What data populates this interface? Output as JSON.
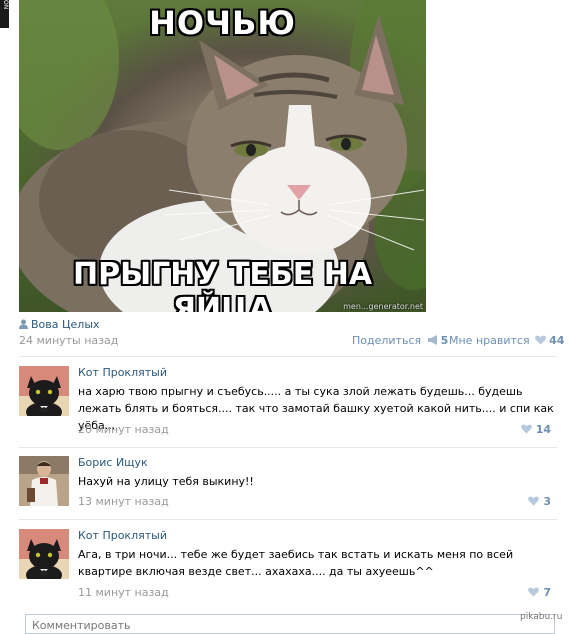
{
  "corner_text": "ON",
  "meme": {
    "top_text": "НОЧЬЮ",
    "bottom_text": "ПРЫГНУ ТЕБЕ НА ЯЙЦА",
    "watermark": "men...generator.net"
  },
  "post": {
    "author": "Вова Целых",
    "time": "24 минуты назад",
    "share_label": "Поделиться",
    "share_count": "5",
    "like_label": "Мне нравится",
    "like_count": "44"
  },
  "comments": [
    {
      "name": "Кот Проклятый",
      "text": "на харю твою прыгну и съебусь..... а ты сука злой лежать будешь... будешь лежать блять и бояться.... так что замотай башку хуетой какой нить.... и спи как уёба...",
      "time": "20 минут назад",
      "likes": "14"
    },
    {
      "name": "Борис Ищук",
      "text": "Нахуй на улицу тебя выкину!!",
      "time": "13 минут назад",
      "likes": "3"
    },
    {
      "name": "Кот Проклятый",
      "text": "Ага, в три ночи... тебе же будет заебись так встать и искать меня по всей квартире включая везде свет... ахахаха.... да ты ахуеешь^^",
      "time": "11 минут назад",
      "likes": "7"
    }
  ],
  "comment_input": {
    "placeholder": "Комментировать"
  },
  "site_watermark": "pikabu.ru"
}
